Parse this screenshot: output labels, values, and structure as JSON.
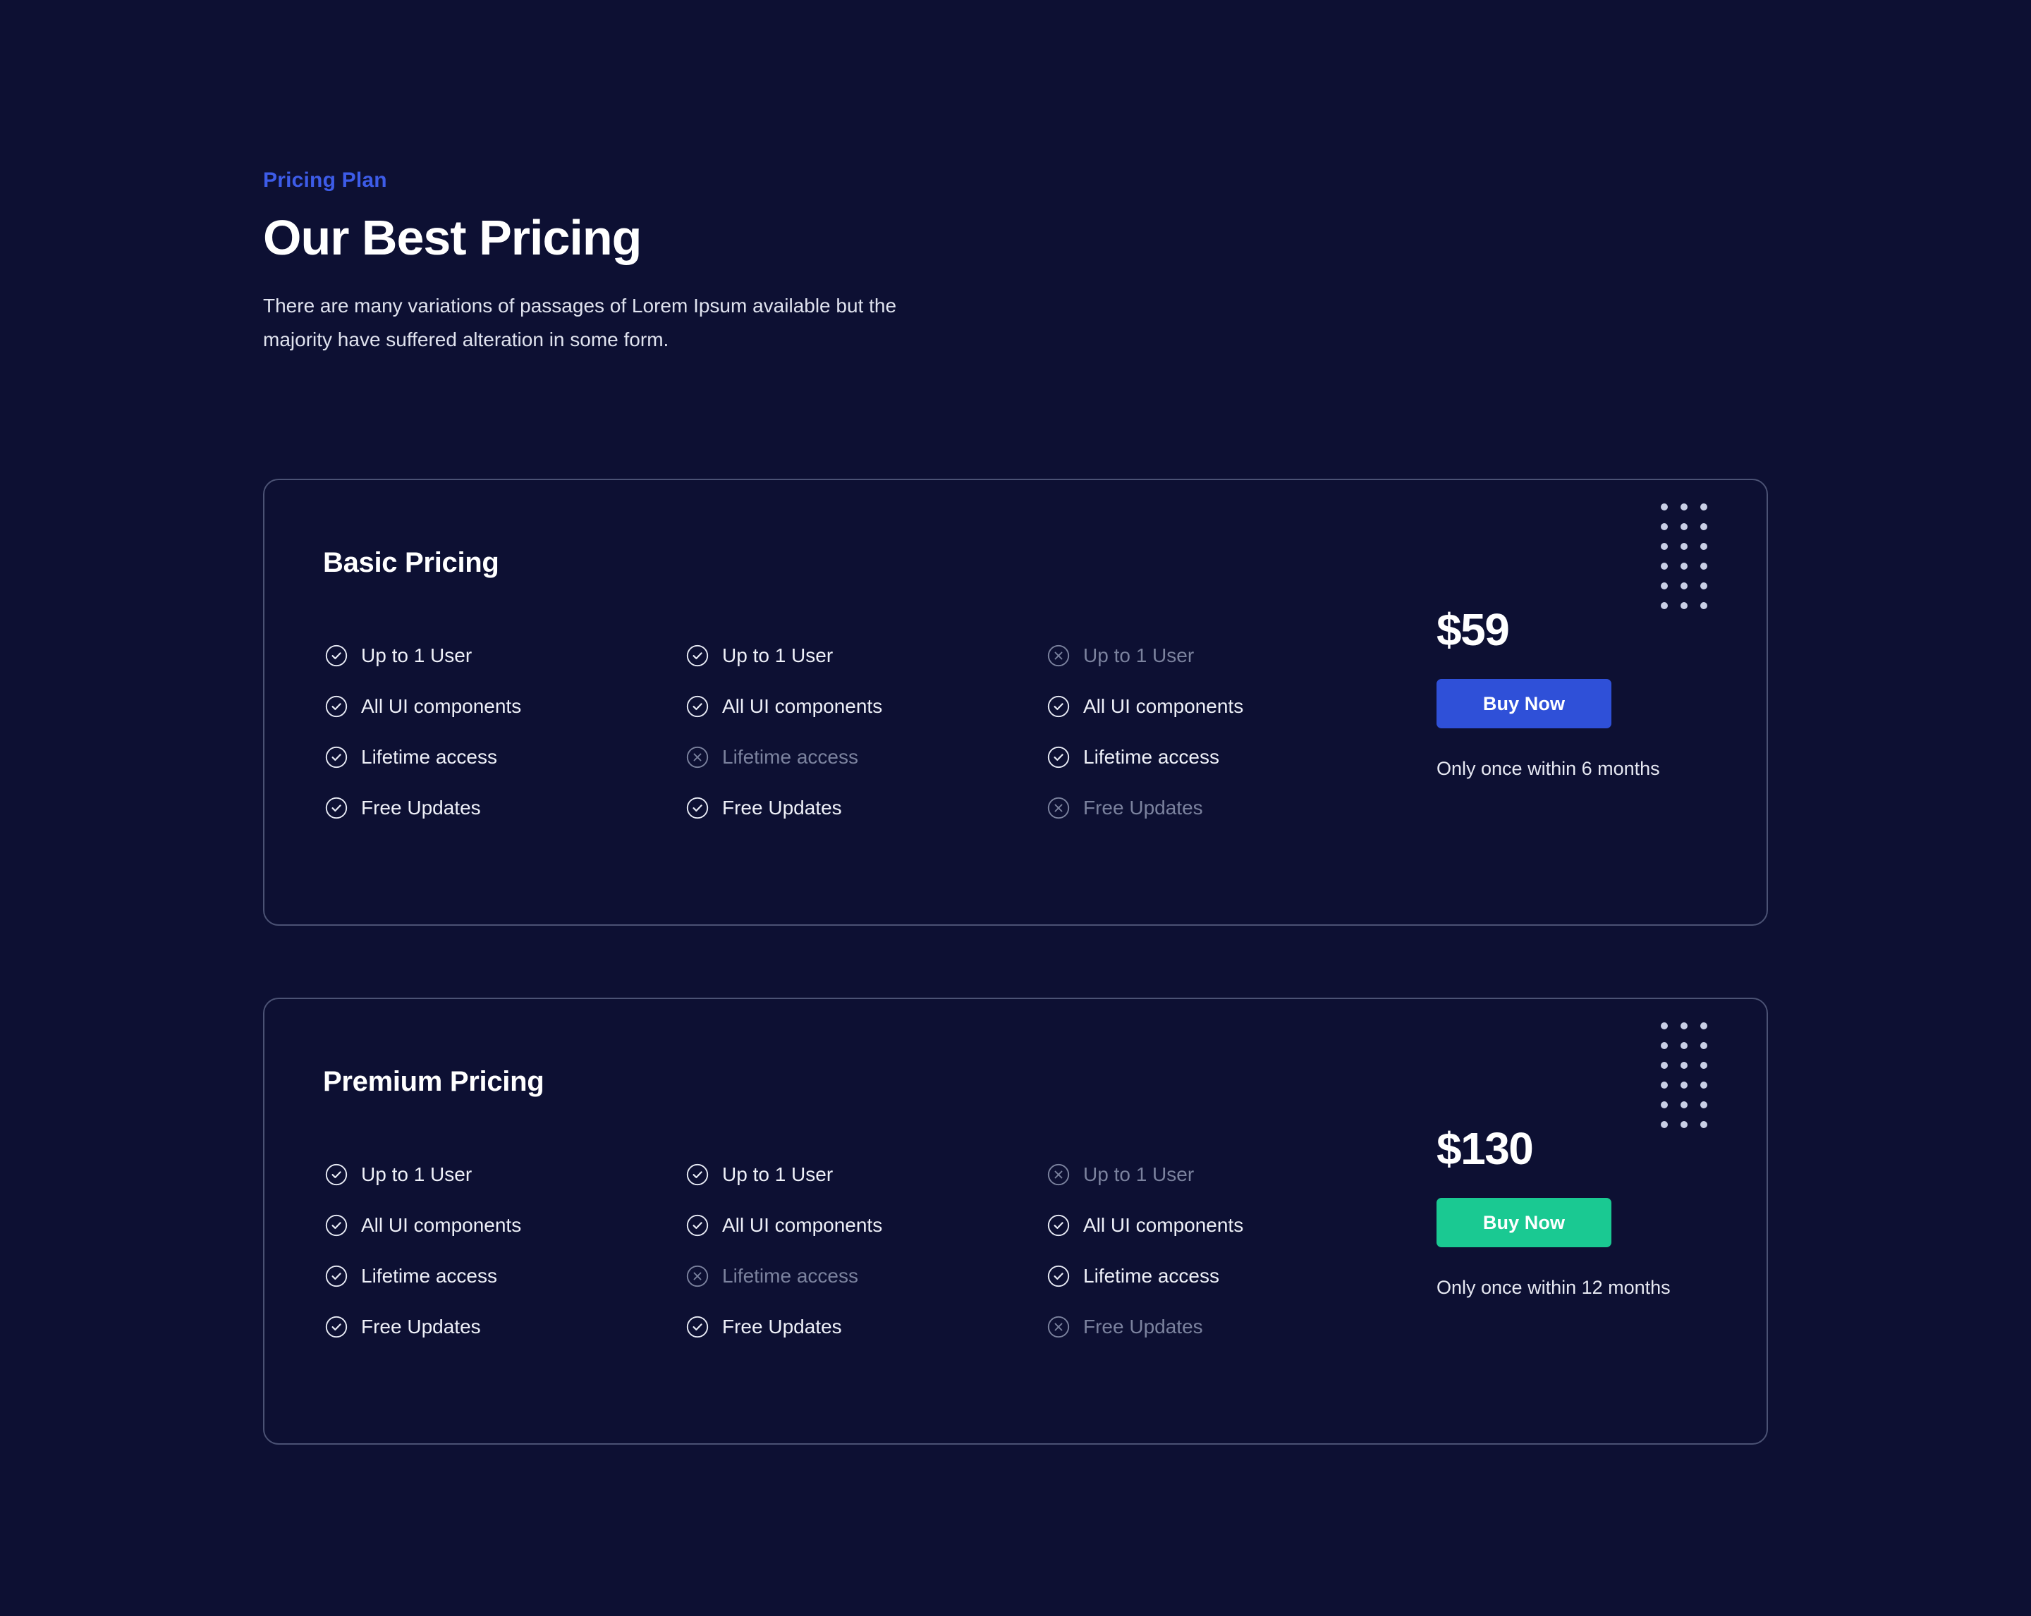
{
  "theme": {
    "background": "#0d1033",
    "accent_blue": "#3d5ce8",
    "button_blue": "#2f50d8",
    "button_green": "#1ac992",
    "card_border": "#4b5274",
    "text_primary": "#ffffff",
    "text_muted": "#7b829e",
    "dot_color": "#c9cfe6"
  },
  "header": {
    "eyebrow": "Pricing Plan",
    "headline": "Our Best Pricing",
    "subhead": "There are many variations of passages of Lorem Ipsum available but the majority have suffered alteration in some form."
  },
  "cards": [
    {
      "id": "basic",
      "title": "Basic Pricing",
      "price": "$59",
      "buy_label": "Buy Now",
      "buy_color": "blue",
      "note": "Only once within 6 months",
      "decoration": "dot-grid-3x6",
      "columns": [
        {
          "items": [
            {
              "label": "Up to 1 User",
              "icon": "check-circle-icon",
              "enabled": true
            },
            {
              "label": "All UI components",
              "icon": "check-circle-icon",
              "enabled": true
            },
            {
              "label": "Lifetime access",
              "icon": "check-circle-icon",
              "enabled": true
            },
            {
              "label": "Free Updates",
              "icon": "check-circle-icon",
              "enabled": true
            }
          ]
        },
        {
          "items": [
            {
              "label": "Up to 1 User",
              "icon": "check-circle-icon",
              "enabled": true
            },
            {
              "label": "All UI components",
              "icon": "check-circle-icon",
              "enabled": true
            },
            {
              "label": "Lifetime access",
              "icon": "cross-circle-icon",
              "enabled": false
            },
            {
              "label": "Free Updates",
              "icon": "check-circle-icon",
              "enabled": true
            }
          ]
        },
        {
          "items": [
            {
              "label": "Up to 1 User",
              "icon": "cross-circle-icon",
              "enabled": false
            },
            {
              "label": "All UI components",
              "icon": "check-circle-icon",
              "enabled": true
            },
            {
              "label": "Lifetime access",
              "icon": "check-circle-icon",
              "enabled": true
            },
            {
              "label": "Free Updates",
              "icon": "cross-circle-icon",
              "enabled": false
            }
          ]
        }
      ]
    },
    {
      "id": "premium",
      "title": "Premium Pricing",
      "price": "$130",
      "buy_label": "Buy Now",
      "buy_color": "green",
      "note": "Only once within 12 months",
      "decoration": "dot-grid-3x6",
      "columns": [
        {
          "items": [
            {
              "label": "Up to 1 User",
              "icon": "check-circle-icon",
              "enabled": true
            },
            {
              "label": "All UI components",
              "icon": "check-circle-icon",
              "enabled": true
            },
            {
              "label": "Lifetime access",
              "icon": "check-circle-icon",
              "enabled": true
            },
            {
              "label": "Free Updates",
              "icon": "check-circle-icon",
              "enabled": true
            }
          ]
        },
        {
          "items": [
            {
              "label": "Up to 1 User",
              "icon": "check-circle-icon",
              "enabled": true
            },
            {
              "label": "All UI components",
              "icon": "check-circle-icon",
              "enabled": true
            },
            {
              "label": "Lifetime access",
              "icon": "cross-circle-icon",
              "enabled": false
            },
            {
              "label": "Free Updates",
              "icon": "check-circle-icon",
              "enabled": true
            }
          ]
        },
        {
          "items": [
            {
              "label": "Up to 1 User",
              "icon": "cross-circle-icon",
              "enabled": false
            },
            {
              "label": "All UI components",
              "icon": "check-circle-icon",
              "enabled": true
            },
            {
              "label": "Lifetime access",
              "icon": "check-circle-icon",
              "enabled": true
            },
            {
              "label": "Free Updates",
              "icon": "cross-circle-icon",
              "enabled": false
            }
          ]
        }
      ]
    }
  ]
}
